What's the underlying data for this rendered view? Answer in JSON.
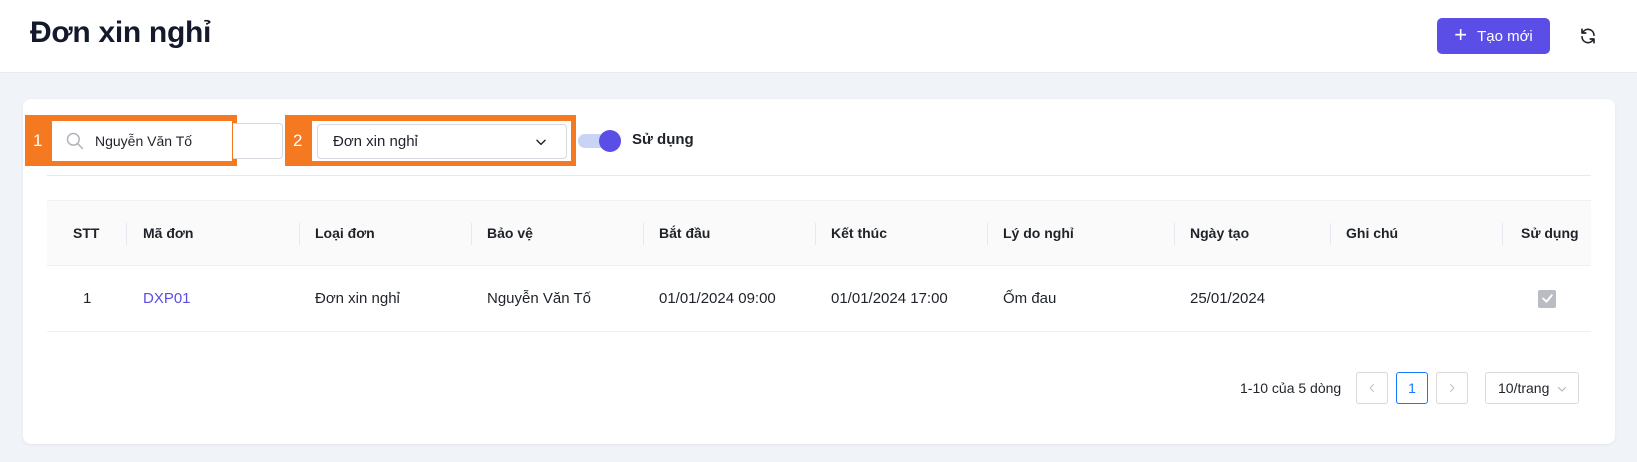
{
  "header": {
    "title": "Đơn xin nghỉ",
    "create_label": "Tạo mới",
    "accent": "#5b4ee6"
  },
  "filters": {
    "annotation_1": "1",
    "annotation_2": "2",
    "search_value": "Nguyễn Văn Tố",
    "select_value": "Đơn xin nghỉ",
    "toggle_label": "Sử dụng",
    "toggle_on": true
  },
  "table": {
    "columns": [
      "STT",
      "Mã đơn",
      "Loại đơn",
      "Bảo vệ",
      "Bắt đầu",
      "Kết thúc",
      "Lý do nghỉ",
      "Ngày tạo",
      "Ghi chú",
      "Sử dụng"
    ],
    "rows": [
      {
        "stt": "1",
        "code": "DXP01",
        "type": "Đơn xin nghỉ",
        "guard": "Nguyễn Văn Tố",
        "start": "01/01/2024 09:00",
        "end": "01/01/2024 17:00",
        "reason": "Ốm đau",
        "created": "25/01/2024",
        "note": "",
        "active": true
      }
    ]
  },
  "pagination": {
    "total_text": "1-10 của 5 dòng",
    "current_page": "1",
    "page_size": "10/trang"
  },
  "icons": [
    "plus-icon",
    "refresh-icon",
    "search-icon",
    "chevron-down-icon",
    "chevron-left-icon",
    "chevron-right-icon",
    "check-icon"
  ]
}
